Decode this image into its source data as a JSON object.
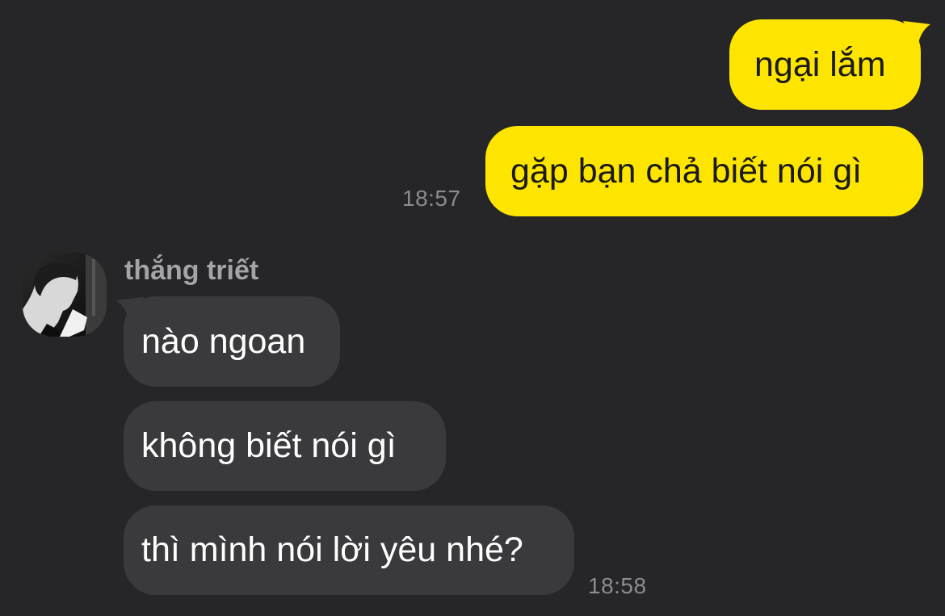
{
  "outgoing": [
    {
      "text": "ngại lắm"
    },
    {
      "text": "gặp bạn chả biết nói gì"
    }
  ],
  "outgoing_time": "18:57",
  "incoming_sender": {
    "name": "thắng triết",
    "avatar_icon": "profile-photo"
  },
  "incoming": [
    {
      "text": "nào ngoan"
    },
    {
      "text": "không biết nói gì"
    },
    {
      "text": "thì mình nói lời yêu nhé?"
    }
  ],
  "incoming_time": "18:58",
  "colors": {
    "background": "#262628",
    "outgoing_bubble": "#fee500",
    "incoming_bubble": "#3a3a3d",
    "timestamp": "#8c8c90"
  }
}
